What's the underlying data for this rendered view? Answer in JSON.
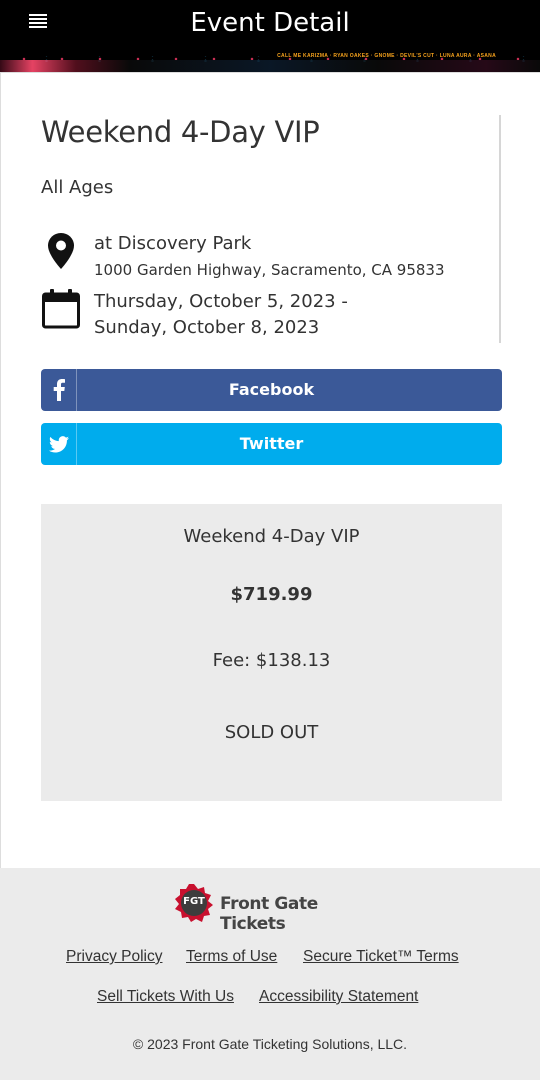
{
  "header": {
    "title": "Event Detail",
    "lineup": "CALL ME KARIZMA · RYAN OAKES · GNOME · DEVIL'S CUT · LUNA AURA · ASANA"
  },
  "event": {
    "title": "Weekend 4-Day VIP",
    "age_restriction": "All Ages",
    "venue_name": "at Discovery Park",
    "venue_address": "1000 Garden Highway, Sacramento, CA 95833",
    "date_start": "Thursday, October 5, 2023 -",
    "date_end": "Sunday, October 8, 2023"
  },
  "share": {
    "facebook_label": "Facebook",
    "twitter_label": "Twitter"
  },
  "ticket": {
    "name": "Weekend 4-Day VIP",
    "price": "$719.99",
    "fee": "Fee:  $138.13",
    "status": "SOLD OUT"
  },
  "footer": {
    "logo_badge": "FGT",
    "logo_text": "Front Gate Tickets",
    "links": {
      "privacy": "Privacy Policy",
      "terms": "Terms of Use",
      "secure": "Secure Ticket™ Terms",
      "sell": "Sell Tickets With Us",
      "accessibility": "Accessibility Statement"
    },
    "copyright": "© 2023 Front Gate Ticketing Solutions, LLC."
  },
  "colors": {
    "facebook": "#3b5998",
    "twitter": "#00aced",
    "panel": "#ebebeb",
    "header_bg": "#000000"
  },
  "icons": [
    "menu-icon",
    "map-pin-icon",
    "calendar-icon",
    "facebook-icon",
    "twitter-icon",
    "fgt-logo-icon"
  ]
}
